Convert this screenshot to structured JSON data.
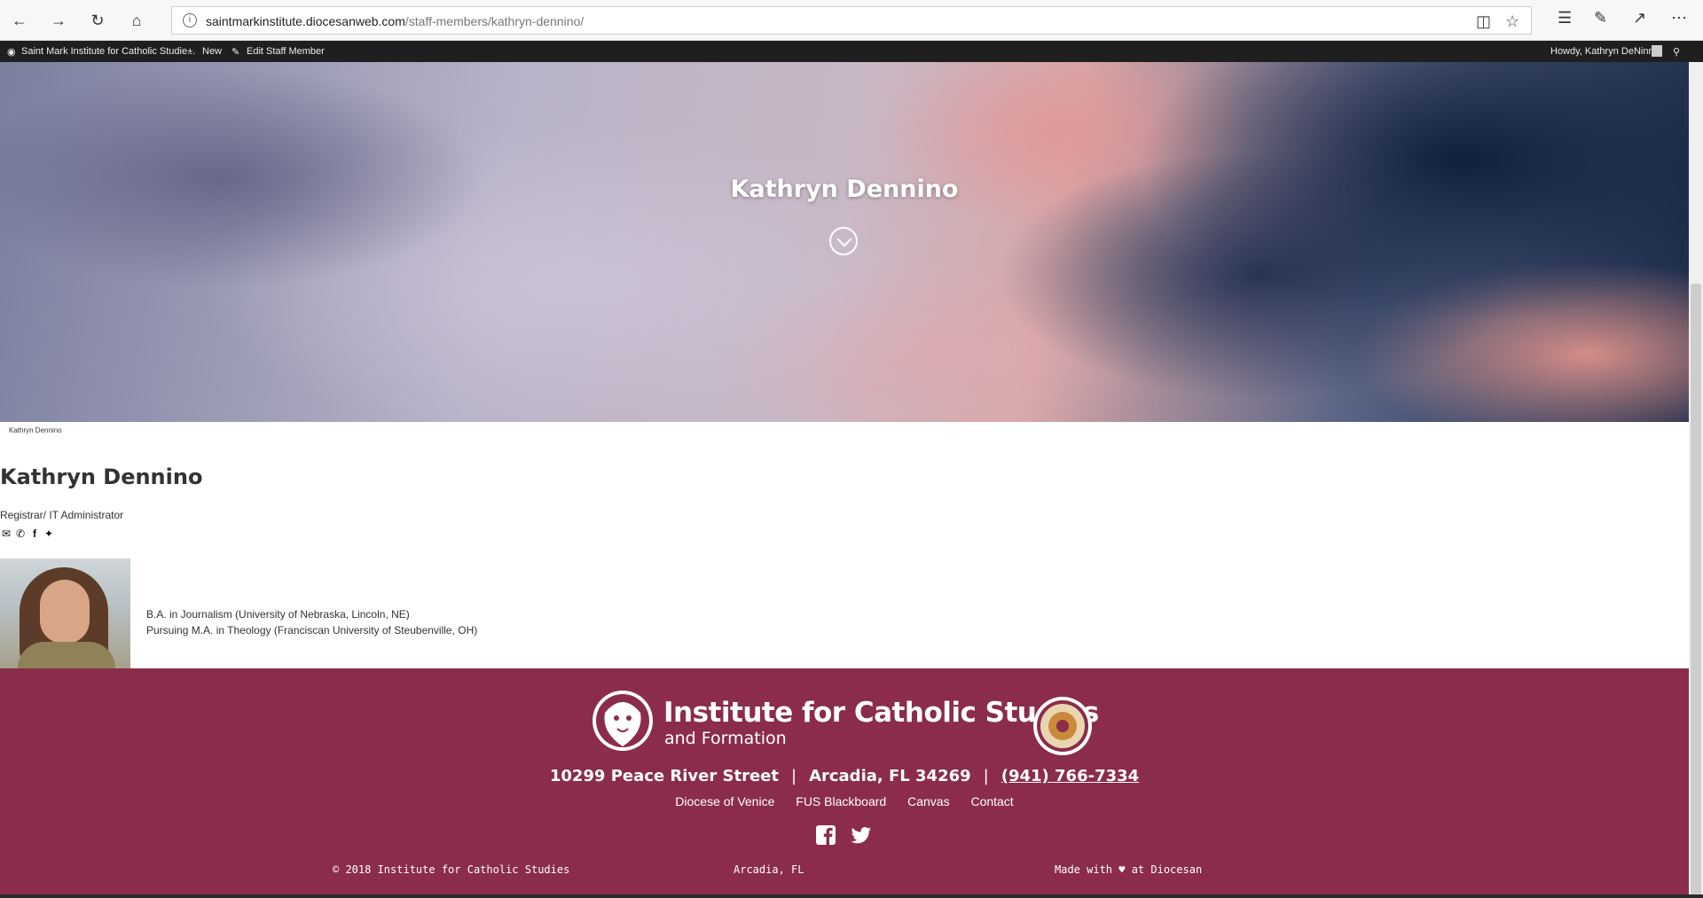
{
  "browser": {
    "url_host": "saintmarkinstitute.diocesanweb.com",
    "url_path": "/staff-members/kathryn-dennino/"
  },
  "admin_bar": {
    "site_name": "Saint Mark Institute for Catholic Studie...",
    "new_label": "New",
    "edit_label": "Edit Staff Member",
    "howdy": "Howdy, Kathryn DeNinno"
  },
  "hero": {
    "title": "Kathryn Dennino",
    "caption": "Kathryn Dennino"
  },
  "staff": {
    "name": "Kathryn Dennino",
    "role": "Registrar/ IT Administrator",
    "education": [
      "B.A. in Journalism (University of Nebraska, Lincoln, NE)",
      "Pursuing M.A. in Theology (Franciscan University of Steubenville, OH)"
    ]
  },
  "footer": {
    "brand_title": "Institute for Catholic Studies",
    "brand_sub": "and Formation",
    "street": "10299 Peace River Street",
    "city": "Arcadia, FL 34269",
    "phone": "(941) 766-7334",
    "links": [
      "Diocese of Venice",
      "FUS Blackboard",
      "Canvas",
      "Contact"
    ],
    "copyright": "© 2018 Institute for Catholic Studies",
    "location": "Arcadia, FL",
    "made_with": "Made with ♥ at Diocesan"
  },
  "colors": {
    "footer_bg": "#8a2c4a",
    "admin_bar_bg": "#1f1f1f"
  }
}
